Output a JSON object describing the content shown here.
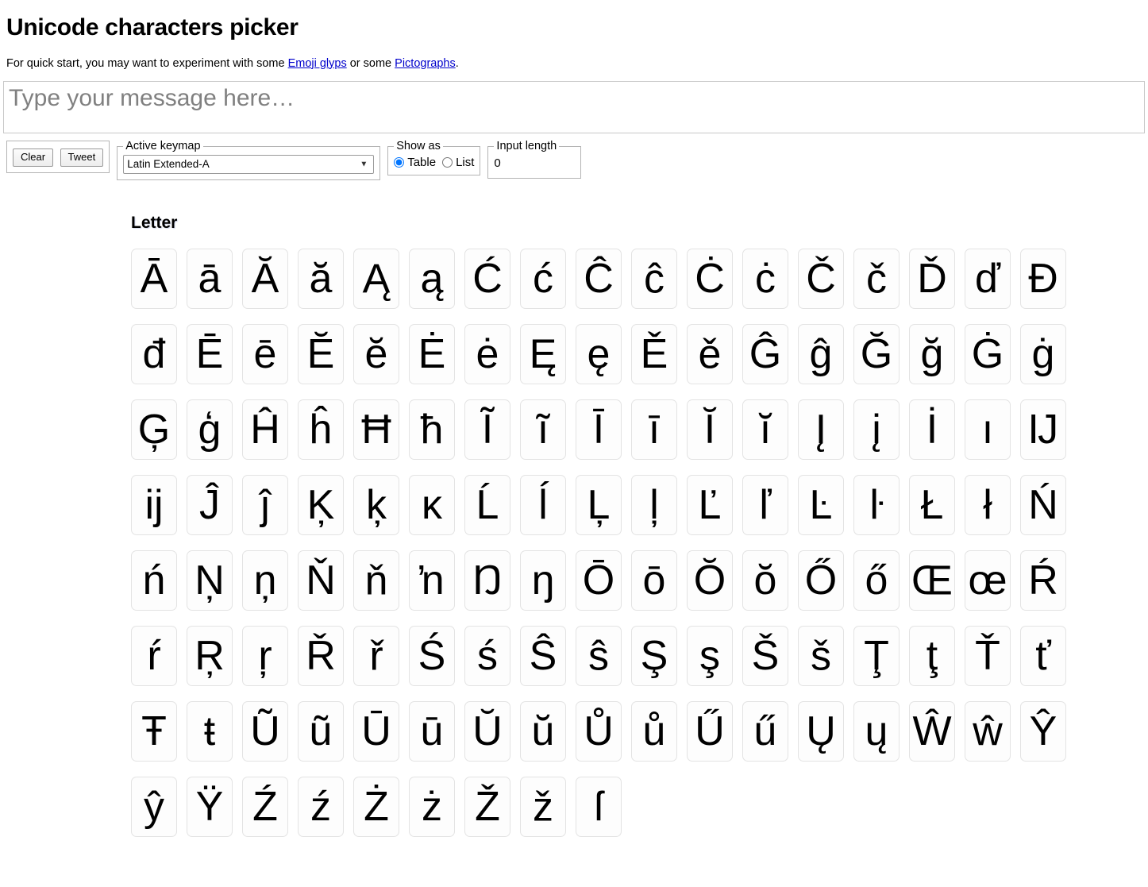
{
  "header": {
    "title": "Unicode characters picker",
    "intro_prefix": "For quick start, you may want to experiment with some ",
    "intro_link1": "Emoji glyps",
    "intro_middle": " or some ",
    "intro_link2": "Pictographs",
    "intro_suffix": "."
  },
  "message": {
    "placeholder": "Type your message here…",
    "value": ""
  },
  "toolbar": {
    "clear_label": "Clear",
    "tweet_label": "Tweet",
    "keymap": {
      "legend": "Active keymap",
      "selected": "Latin Extended-A",
      "options": [
        "Latin Extended-A"
      ]
    },
    "show_as": {
      "legend": "Show as",
      "table_label": "Table",
      "list_label": "List",
      "selected": "Table"
    },
    "input_length": {
      "legend": "Input length",
      "value": "0"
    }
  },
  "category": {
    "title": "Letter",
    "characters": [
      "Ā",
      "ā",
      "Ă",
      "ă",
      "Ą",
      "ą",
      "Ć",
      "ć",
      "Ĉ",
      "ĉ",
      "Ċ",
      "ċ",
      "Č",
      "č",
      "Ď",
      "ď",
      "Đ",
      "đ",
      "Ē",
      "ē",
      "Ĕ",
      "ĕ",
      "Ė",
      "ė",
      "Ę",
      "ę",
      "Ě",
      "ě",
      "Ĝ",
      "ĝ",
      "Ğ",
      "ğ",
      "Ġ",
      "ġ",
      "Ģ",
      "ģ",
      "Ĥ",
      "ĥ",
      "Ħ",
      "ħ",
      "Ĩ",
      "ĩ",
      "Ī",
      "ī",
      "Ĭ",
      "ĭ",
      "Į",
      "į",
      "İ",
      "ı",
      "Ĳ",
      "ĳ",
      "Ĵ",
      "ĵ",
      "Ķ",
      "ķ",
      "ĸ",
      "Ĺ",
      "ĺ",
      "Ļ",
      "ļ",
      "Ľ",
      "ľ",
      "Ŀ",
      "ŀ",
      "Ł",
      "ł",
      "Ń",
      "ń",
      "Ņ",
      "ņ",
      "Ň",
      "ň",
      "ŉ",
      "Ŋ",
      "ŋ",
      "Ō",
      "ō",
      "Ŏ",
      "ŏ",
      "Ő",
      "ő",
      "Œ",
      "œ",
      "Ŕ",
      "ŕ",
      "Ŗ",
      "ŗ",
      "Ř",
      "ř",
      "Ś",
      "ś",
      "Ŝ",
      "ŝ",
      "Ş",
      "ş",
      "Š",
      "š",
      "Ţ",
      "ţ",
      "Ť",
      "ť",
      "Ŧ",
      "ŧ",
      "Ũ",
      "ũ",
      "Ū",
      "ū",
      "Ŭ",
      "ŭ",
      "Ů",
      "ů",
      "Ű",
      "ű",
      "Ų",
      "ų",
      "Ŵ",
      "ŵ",
      "Ŷ",
      "ŷ",
      "Ÿ",
      "Ź",
      "ź",
      "Ż",
      "ż",
      "Ž",
      "ž",
      "ſ"
    ]
  },
  "colors": {
    "link": "#0000cc",
    "key_bg": "#fdfdfd",
    "key_border": "#e3e3e3",
    "placeholder": "#808080"
  }
}
